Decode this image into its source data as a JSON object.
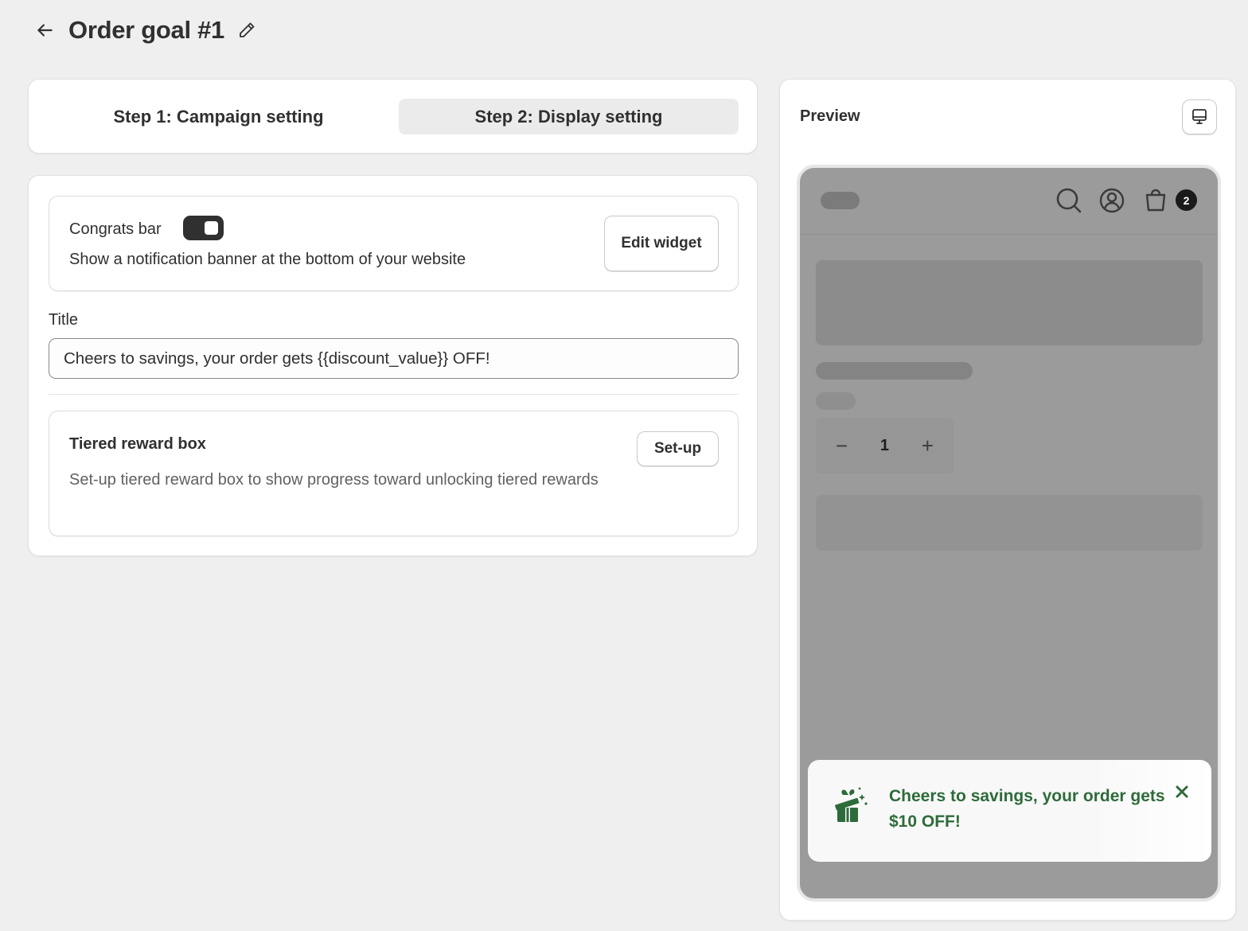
{
  "header": {
    "title": "Order goal #1",
    "back_icon": "arrow-left-icon",
    "edit_icon": "pencil-icon"
  },
  "steps": [
    {
      "label": "Step 1: Campaign setting",
      "active": false
    },
    {
      "label": "Step 2: Display setting",
      "active": true
    }
  ],
  "congrats_bar": {
    "title": "Congrats bar",
    "enabled": true,
    "description": "Show a notification banner at the bottom of your website",
    "edit_button": "Edit widget"
  },
  "title_field": {
    "label": "Title",
    "value": "Cheers to savings, your order gets {{discount_value}} OFF!"
  },
  "tiered_reward": {
    "title": "Tiered reward box",
    "description": "Set-up tiered reward box to show progress toward unlocking tiered rewards",
    "button": "Set-up"
  },
  "preview": {
    "title": "Preview",
    "device_icon": "desktop-icon",
    "cart_count": "2",
    "quantity": "1",
    "quantity_minus": "−",
    "quantity_plus": "+",
    "banner_text": "Cheers to savings, your order gets $10 OFF!",
    "banner_color": "#2e6b3a",
    "banner_close": "✕"
  },
  "colors": {
    "background": "#efefef",
    "toggle_on": "#303030",
    "preview_overlay": "#9b9b9b"
  }
}
